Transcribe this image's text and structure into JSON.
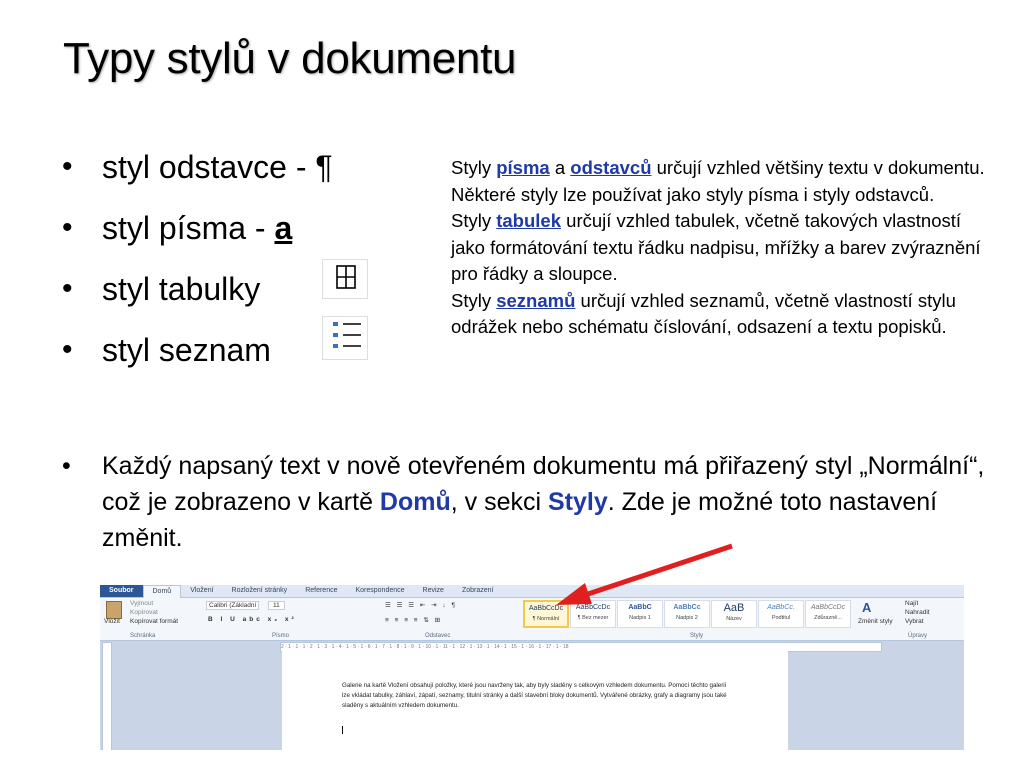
{
  "title": "Typy stylů v dokumentu",
  "bullets": {
    "paragraph_prefix": "styl odstavce - ",
    "paragraph_symbol": "¶",
    "font_prefix": "styl písma - ",
    "font_symbol": "a",
    "table": "styl tabulky",
    "list": "styl seznam"
  },
  "side": {
    "p1_start": "Styly ",
    "p1_link1": "písma",
    "p1_mid": " a ",
    "p1_link2": "odstavců",
    "p1_end": " určují vzhled většiny textu v dokumentu. Některé styly lze používat jako styly písma i styly odstavců.",
    "p2_start": "Styly ",
    "p2_link": "tabulek",
    "p2_end": " určují vzhled tabulek, včetně takových vlastností jako formátování textu řádku nadpisu, mřížky a barev zvýraznění pro řádky a sloupce.",
    "p3_start": " Styly ",
    "p3_link": "seznamů",
    "p3_end": " určují vzhled seznamů, včetně vlastností stylu odrážek nebo schématu číslování, odsazení a textu popisků."
  },
  "bottom": {
    "t1": "Každý napsaný text v nově otevřeném dokumentu má přiřazený styl „Normální“, což je zobrazeno v kartě ",
    "h1": "Domů",
    "t2": ", v sekci ",
    "h2": "Styly",
    "t3": ". Zde je možné toto nastavení změnit."
  },
  "word": {
    "tabs": [
      "Soubor",
      "Domů",
      "Vložení",
      "Rozložení stránky",
      "Reference",
      "Korespondence",
      "Revize",
      "Zobrazení"
    ],
    "clipboard": {
      "paste": "Vložit",
      "cut": "Vyjmout",
      "copy": "Kopírovat",
      "format": "Kopírovat formát",
      "label": "Schránka"
    },
    "font": {
      "name": "Calibri (Základní",
      "size": "11",
      "label": "Písmo"
    },
    "paragraph_label": "Odstavec",
    "styles": [
      {
        "sample": "AaBbCcDc",
        "name": "¶ Normální"
      },
      {
        "sample": "AaBbCcDc",
        "name": "¶ Bez mezer"
      },
      {
        "sample": "AaBbC",
        "name": "Nadpis 1"
      },
      {
        "sample": "AaBbCc",
        "name": "Nadpis 2"
      },
      {
        "sample": "AaB",
        "name": "Název"
      },
      {
        "sample": "AaBbCc.",
        "name": "Podtitul"
      },
      {
        "sample": "AaBbCcDc",
        "name": "Zdůrazně..."
      }
    ],
    "styles_label": "Styly",
    "change_styles": "Změnit styly",
    "editing": {
      "find": "Najít",
      "replace": "Nahradit",
      "select": "Vybrat",
      "label": "Úpravy"
    },
    "ruler": "2 · 1 · 1 · 1 · 2 · 1 · 3 · 1 · 4 · 1 · 5 · 1 · 6 · 1 · 7 · 1 · 8 · 1 · 9 · 1 · 10 · 1 · 11 · 1 · 12 · 1 · 13 · 1 · 14 · 1 · 15 · 1 · 16 · 1 · 17 · 1 · 18",
    "page_text": "Galerie na kartě Vložení obsahují položky, které jsou navrženy tak, aby byly sladěny s celkovým vzhledem dokumentu. Pomocí těchto galerií lze vkládat tabulky, záhlaví, zápatí, seznamy, titulní stránky a další stavební bloky dokumentů. Vytvářené obrázky, grafy a diagramy jsou také sladěny s aktuálním vzhledem dokumentu."
  },
  "colors": {
    "link": "#1f3aa6",
    "arrow": "#e01f1f",
    "file_tab": "#2b5797"
  }
}
